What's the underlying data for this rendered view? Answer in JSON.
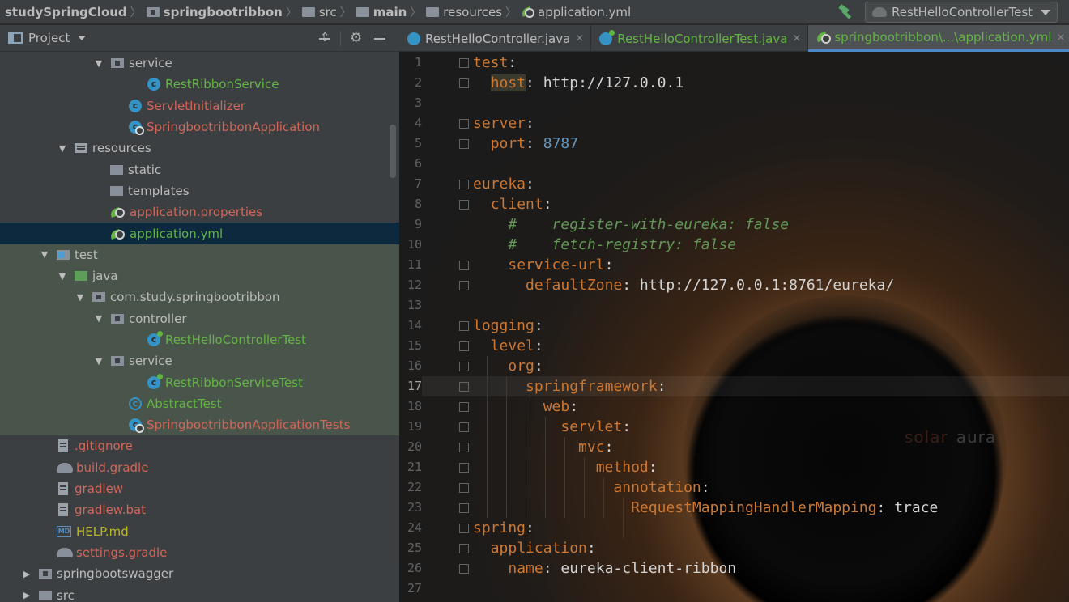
{
  "breadcrumb": [
    {
      "label": "studySpringCloud",
      "icon": "none",
      "bold": true
    },
    {
      "label": "springbootribbon",
      "icon": "module-folder-icon",
      "bold": true
    },
    {
      "label": "src",
      "icon": "folder-icon",
      "bold": false
    },
    {
      "label": "main",
      "icon": "folder-icon",
      "bold": true
    },
    {
      "label": "resources",
      "icon": "resources-folder-icon",
      "bold": false
    },
    {
      "label": "application.yml",
      "icon": "spring-leaf-icon",
      "bold": false
    }
  ],
  "run_config": {
    "label": "RestHelloControllerTest"
  },
  "project_panel": {
    "title": "Project"
  },
  "tree": [
    {
      "label": "service",
      "icon": "package",
      "arrow": "▼",
      "indent": 137,
      "color": "def",
      "bg": ""
    },
    {
      "label": "RestRibbonService",
      "icon": "class",
      "arrow": "",
      "indent": 182,
      "color": "green",
      "bg": ""
    },
    {
      "label": "ServletInitializer",
      "icon": "class",
      "arrow": "",
      "indent": 159,
      "color": "red",
      "bg": ""
    },
    {
      "label": "SpringbootribbonApplication",
      "icon": "class-spring",
      "arrow": "",
      "indent": 159,
      "color": "red",
      "bg": ""
    },
    {
      "label": "resources",
      "icon": "resources",
      "arrow": "▼",
      "indent": 92,
      "color": "def",
      "bg": ""
    },
    {
      "label": "static",
      "icon": "folder",
      "arrow": "",
      "indent": 136,
      "color": "def",
      "bg": ""
    },
    {
      "label": "templates",
      "icon": "folder",
      "arrow": "",
      "indent": 136,
      "color": "def",
      "bg": ""
    },
    {
      "label": "application.properties",
      "icon": "leaf",
      "arrow": "",
      "indent": 136,
      "color": "red",
      "bg": ""
    },
    {
      "label": "application.yml",
      "icon": "leaf",
      "arrow": "",
      "indent": 136,
      "color": "green",
      "bg": "sel"
    },
    {
      "label": "test",
      "icon": "test",
      "arrow": "▼",
      "indent": 70,
      "color": "def",
      "bg": "test"
    },
    {
      "label": "java",
      "icon": "src",
      "arrow": "▼",
      "indent": 92,
      "color": "def",
      "bg": "test"
    },
    {
      "label": "com.study.springbootribbon",
      "icon": "package",
      "arrow": "▼",
      "indent": 114,
      "color": "def",
      "bg": "test"
    },
    {
      "label": "controller",
      "icon": "package",
      "arrow": "▼",
      "indent": 137,
      "color": "def",
      "bg": "test"
    },
    {
      "label": "RestHelloControllerTest",
      "icon": "class-test",
      "arrow": "",
      "indent": 182,
      "color": "green",
      "bg": "test"
    },
    {
      "label": "service",
      "icon": "package",
      "arrow": "▼",
      "indent": 137,
      "color": "def",
      "bg": "test"
    },
    {
      "label": "RestRibbonServiceTest",
      "icon": "class-test",
      "arrow": "",
      "indent": 182,
      "color": "green",
      "bg": "test"
    },
    {
      "label": "AbstractTest",
      "icon": "class-abs",
      "arrow": "",
      "indent": 159,
      "color": "green",
      "bg": "test"
    },
    {
      "label": "SpringbootribbonApplicationTests",
      "icon": "class-spring",
      "arrow": "",
      "indent": 159,
      "color": "red",
      "bg": "test"
    },
    {
      "label": ".gitignore",
      "icon": "file",
      "arrow": "",
      "indent": 70,
      "color": "red",
      "bg": ""
    },
    {
      "label": "build.gradle",
      "icon": "gradle",
      "arrow": "",
      "indent": 70,
      "color": "red",
      "bg": ""
    },
    {
      "label": "gradlew",
      "icon": "file",
      "arrow": "",
      "indent": 70,
      "color": "red",
      "bg": ""
    },
    {
      "label": "gradlew.bat",
      "icon": "file",
      "arrow": "",
      "indent": 70,
      "color": "red",
      "bg": ""
    },
    {
      "label": "HELP.md",
      "icon": "md",
      "arrow": "",
      "indent": 70,
      "color": "olive",
      "bg": ""
    },
    {
      "label": "settings.gradle",
      "icon": "gradle",
      "arrow": "",
      "indent": 70,
      "color": "red",
      "bg": ""
    },
    {
      "label": "springbootswagger",
      "icon": "module",
      "arrow": "▶",
      "indent": 48,
      "color": "def",
      "bg": ""
    },
    {
      "label": "src",
      "icon": "folder",
      "arrow": "▶",
      "indent": 48,
      "color": "def",
      "bg": ""
    }
  ],
  "tabs": [
    {
      "label": "RestHelloController.java",
      "icon": "class",
      "color": "def",
      "active": false,
      "close": "×"
    },
    {
      "label": "RestHelloControllerTest.java",
      "icon": "class-test",
      "color": "green",
      "active": false,
      "close": "×"
    },
    {
      "label": "springbootribbon\\...\\application.yml",
      "icon": "leaf",
      "color": "green",
      "active": true,
      "close": "×"
    }
  ],
  "current_line": 17,
  "code_lines": [
    [
      {
        "t": "test",
        "c": "k"
      },
      {
        "t": ":",
        "c": "v"
      }
    ],
    [
      {
        "t": "  "
      },
      {
        "t": "host",
        "c": "k hl"
      },
      {
        "t": ": http://127.0.0.1",
        "c": "v"
      }
    ],
    [],
    [
      {
        "t": "server",
        "c": "k"
      },
      {
        "t": ":",
        "c": "v"
      }
    ],
    [
      {
        "t": "  "
      },
      {
        "t": "port",
        "c": "k"
      },
      {
        "t": ": ",
        "c": "v"
      },
      {
        "t": "8787",
        "c": "n"
      }
    ],
    [],
    [
      {
        "t": "eureka",
        "c": "k"
      },
      {
        "t": ":",
        "c": "v"
      }
    ],
    [
      {
        "t": "  "
      },
      {
        "t": "client",
        "c": "k"
      },
      {
        "t": ":",
        "c": "v"
      }
    ],
    [
      {
        "t": "    "
      },
      {
        "t": "#    register-with-eureka: false",
        "c": "cm"
      }
    ],
    [
      {
        "t": "    "
      },
      {
        "t": "#    fetch-registry: false",
        "c": "cm"
      }
    ],
    [
      {
        "t": "    "
      },
      {
        "t": "service-url",
        "c": "k"
      },
      {
        "t": ":",
        "c": "v"
      }
    ],
    [
      {
        "t": "      "
      },
      {
        "t": "defaultZone",
        "c": "k"
      },
      {
        "t": ": http://127.0.0.1:8761/eureka/",
        "c": "v"
      }
    ],
    [],
    [
      {
        "t": "logging",
        "c": "k"
      },
      {
        "t": ":",
        "c": "v"
      }
    ],
    [
      {
        "t": "  "
      },
      {
        "t": "level",
        "c": "k"
      },
      {
        "t": ":",
        "c": "v"
      }
    ],
    [
      {
        "t": "    "
      },
      {
        "t": "org",
        "c": "k"
      },
      {
        "t": ":",
        "c": "v"
      }
    ],
    [
      {
        "t": "      "
      },
      {
        "t": "springframework",
        "c": "k"
      },
      {
        "t": ":",
        "c": "v"
      }
    ],
    [
      {
        "t": "        "
      },
      {
        "t": "web",
        "c": "k"
      },
      {
        "t": ":",
        "c": "v"
      }
    ],
    [
      {
        "t": "          "
      },
      {
        "t": "servlet",
        "c": "k"
      },
      {
        "t": ":",
        "c": "v"
      }
    ],
    [
      {
        "t": "            "
      },
      {
        "t": "mvc",
        "c": "k"
      },
      {
        "t": ":",
        "c": "v"
      }
    ],
    [
      {
        "t": "              "
      },
      {
        "t": "method",
        "c": "k"
      },
      {
        "t": ":",
        "c": "v"
      }
    ],
    [
      {
        "t": "                "
      },
      {
        "t": "annotation",
        "c": "k"
      },
      {
        "t": ":",
        "c": "v"
      }
    ],
    [
      {
        "t": "                  "
      },
      {
        "t": "RequestMappingHandlerMapping",
        "c": "k"
      },
      {
        "t": ": trace",
        "c": "v"
      }
    ],
    [
      {
        "t": "spring",
        "c": "k"
      },
      {
        "t": ":",
        "c": "v"
      }
    ],
    [
      {
        "t": "  "
      },
      {
        "t": "application",
        "c": "k"
      },
      {
        "t": ":",
        "c": "v"
      }
    ],
    [
      {
        "t": "    "
      },
      {
        "t": "name",
        "c": "k"
      },
      {
        "t": ": eureka-client-ribbon",
        "c": "v"
      }
    ],
    []
  ],
  "fold_lines": [
    1,
    2,
    4,
    5,
    7,
    8,
    11,
    12,
    14,
    15,
    16,
    17,
    18,
    19,
    20,
    21,
    22,
    23,
    24,
    25,
    26
  ],
  "watermark": {
    "part1": "solar",
    "part2": "aura"
  },
  "colors": {
    "keyword": "#cc7832",
    "number": "#6897bb",
    "comment": "#629755",
    "modified_file": "#d1675a",
    "new_file": "#62b543"
  }
}
